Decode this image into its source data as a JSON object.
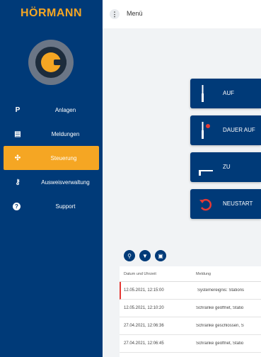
{
  "brand": {
    "name": "HÖRMANN"
  },
  "colors": {
    "sidebar": "#003a78",
    "accent": "#f5a623",
    "alert": "#e53935"
  },
  "sidebar": {
    "items": [
      {
        "label": "Anlagen",
        "icon": "parking-icon",
        "glyph": "P",
        "active": false
      },
      {
        "label": "Meldungen",
        "icon": "message-icon",
        "glyph": "▤",
        "active": false
      },
      {
        "label": "Steuerung",
        "icon": "control-icon",
        "glyph": "✣",
        "active": true
      },
      {
        "label": "Ausweisverwaltung",
        "icon": "key-icon",
        "glyph": "⚷",
        "active": false
      },
      {
        "label": "Support",
        "icon": "help-icon",
        "glyph": "?",
        "active": false
      }
    ]
  },
  "topbar": {
    "menu_label": "Menü",
    "menu_glyph": "⋮"
  },
  "controls": [
    {
      "label": "AUF",
      "icon": "barrier-up-icon"
    },
    {
      "label": "DAUER AUF",
      "icon": "barrier-permanent-open-icon"
    },
    {
      "label": "ZU",
      "icon": "barrier-down-icon"
    },
    {
      "label": "NEUSTART",
      "icon": "restart-icon"
    }
  ],
  "toolbar": {
    "search_glyph": "⚲",
    "filter_glyph": "▼",
    "export_glyph": "▣"
  },
  "table": {
    "headers": {
      "date": "Datum und Uhrzeit",
      "message": "Meldung"
    },
    "rows": [
      {
        "date": "12.05.2021, 12:15:00",
        "message": "Systemereignis: Stations",
        "alert": true
      },
      {
        "date": "12.05.2021, 12:10:20",
        "message": "Schranke geöffnet, Statio",
        "alert": false
      },
      {
        "date": "27.04.2021, 12:06:36",
        "message": "Schranke geschlossen, S",
        "alert": false
      },
      {
        "date": "27.04.2021, 12:06:45",
        "message": "Schranke geöffnet, Statio",
        "alert": false
      }
    ]
  }
}
